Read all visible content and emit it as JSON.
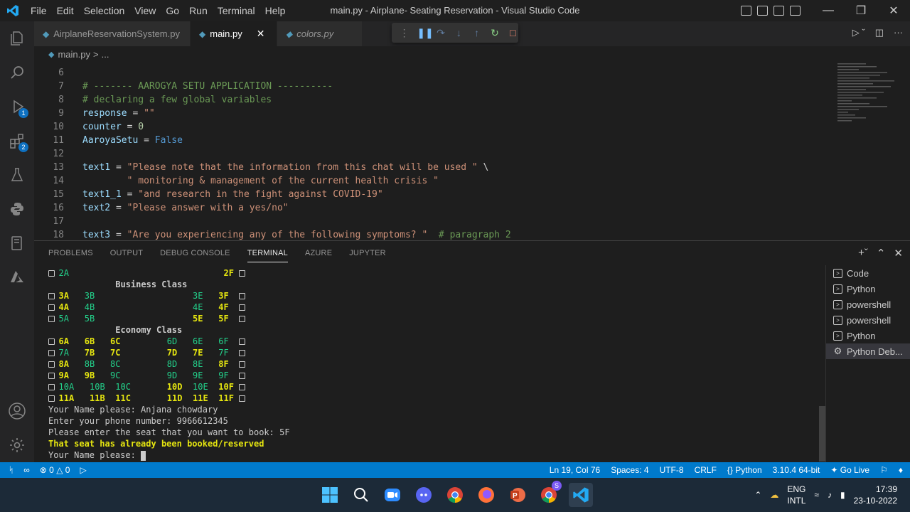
{
  "app": {
    "menus": [
      "File",
      "Edit",
      "Selection",
      "View",
      "Go",
      "Run",
      "Terminal",
      "Help"
    ],
    "window_title": "main.py - Airplane- Seating Reservation - Visual Studio Code",
    "activity_badges": {
      "run": "1",
      "extensions": "2"
    }
  },
  "tabs": [
    {
      "label": "AirplaneReservationSystem.py"
    },
    {
      "label": "main.py"
    },
    {
      "label": "colors.py"
    }
  ],
  "breadcrumb": {
    "file": "main.py",
    "sep": ">",
    "more": "..."
  },
  "editor": {
    "lines": [
      {
        "n": "6"
      },
      {
        "n": "7",
        "c1": "# ------- AAROGYA SETU APPLICATION ----------"
      },
      {
        "n": "8",
        "c1": "# declaring a few global variables"
      },
      {
        "n": "9",
        "v": "response",
        "op": " = ",
        "s": "\"\""
      },
      {
        "n": "10",
        "v": "counter",
        "op": " = ",
        "num": "0"
      },
      {
        "n": "11",
        "v": "AaroyaSetu",
        "op": " = ",
        "k": "False"
      },
      {
        "n": "12"
      },
      {
        "n": "13",
        "v": "text1",
        "op": " = ",
        "s": "\"Please note that the information from this chat will be used \"",
        "tail": " \\"
      },
      {
        "n": "14",
        "pad": "        ",
        "s": "\" monitoring & management of the current health crisis \""
      },
      {
        "n": "15",
        "v": "text1_1",
        "op": " = ",
        "s": "\"and research in the fight against COVID-19\""
      },
      {
        "n": "16",
        "v": "text2",
        "op": " = ",
        "s": "\"Please answer with a yes/no\""
      },
      {
        "n": "17"
      },
      {
        "n": "18",
        "v": "text3",
        "op": " = ",
        "s": "\"Are you experiencing any of the following symptoms? \"",
        "c2": "  # paragraph 2"
      }
    ]
  },
  "panel": {
    "tabs": [
      "PROBLEMS",
      "OUTPUT",
      "DEBUG CONSOLE",
      "TERMINAL",
      "AZURE",
      "JUPYTER"
    ],
    "active_tab": "TERMINAL",
    "terminal_list": [
      "Code",
      "Python",
      "powershell",
      "powershell",
      "Python",
      "Python Deb..."
    ]
  },
  "terminal": {
    "row_2A": "2A",
    "row_2F": "2F",
    "business": "Business Class",
    "economy": "Economy Class",
    "seats": [
      [
        "3A",
        "3B",
        "3E",
        "3F"
      ],
      [
        "4A",
        "4B",
        "4E",
        "4F"
      ],
      [
        "5A",
        "5B",
        "5E",
        "5F"
      ]
    ],
    "eseats": [
      [
        "6A",
        "6B",
        "6C",
        "6D",
        "6E",
        "6F"
      ],
      [
        "7A",
        "7B",
        "7C",
        "7D",
        "7E",
        "7F"
      ],
      [
        "8A",
        "8B",
        "8C",
        "8D",
        "8E",
        "8F"
      ],
      [
        "9A",
        "9B",
        "9C",
        "9D",
        "9E",
        "9F"
      ],
      [
        "10A",
        "10B",
        "10C",
        "10D",
        "10E",
        "10F"
      ],
      [
        "11A",
        "11B",
        "11C",
        "11D",
        "11E",
        "11F"
      ]
    ],
    "prompt_name": "Your Name please: Anjana chowdary",
    "prompt_phone": "Enter your phone number: 9966612345",
    "prompt_seat": "Please enter the seat that you want to book: 5F",
    "message_booked": "That seat has already been booked/reserved",
    "prompt_again": "Your Name please: "
  },
  "statusbar": {
    "errors": "0",
    "warnings": "0",
    "position": "Ln 19, Col 76",
    "spaces": "Spaces: 4",
    "encoding": "UTF-8",
    "eol": "CRLF",
    "language": "Python",
    "interpreter": "3.10.4 64-bit",
    "golive": "Go Live"
  },
  "taskbar": {
    "lang1": "ENG",
    "lang2": "INTL",
    "time": "17:39",
    "date": "23-10-2022",
    "chrome_badge": "S"
  },
  "colors": {
    "status_blue": "#007acc",
    "terminal_yellow": "#e5e510",
    "terminal_green": "#23d18b"
  }
}
